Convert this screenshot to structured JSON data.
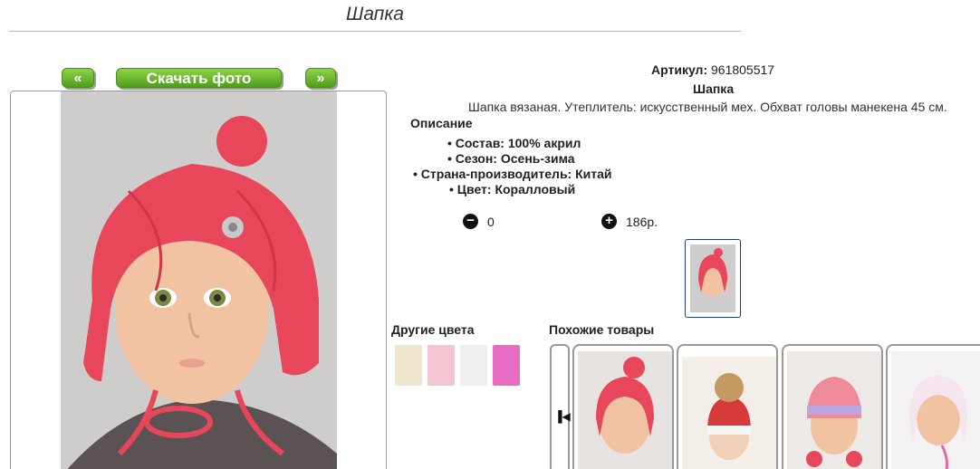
{
  "page": {
    "title": "Шапка"
  },
  "buttons": {
    "prev": "«",
    "download": "Скачать фото",
    "next": "»"
  },
  "product": {
    "article_label": "Артикул:",
    "article_value": "961805517",
    "name": "Шапка",
    "description": "Шапка вязаная. Утеплитель: искусственный мех. Обхват головы манекена 45 см.",
    "description_heading": "Описание",
    "specs": [
      "Состав: 100% акрил",
      "Сезон: Осень-зима",
      "Страна-производитель: Китай",
      "Цвет: Коралловый"
    ]
  },
  "quantity": {
    "minus_icon": "minus-circle-icon",
    "value": "0",
    "plus_icon": "plus-circle-icon",
    "price": "186р."
  },
  "sections": {
    "other_colors": "Другие цвета",
    "similar": "Похожие товары"
  },
  "colors": {
    "accent_green": "#5aa823",
    "hat_coral": "#e8465a",
    "thumb_border": "#1d3c7a"
  },
  "other_colors": [
    {
      "name": "cream",
      "hex": "#efe6cf"
    },
    {
      "name": "pink",
      "hex": "#f2c5d0"
    },
    {
      "name": "white",
      "hex": "#f1f1f1"
    },
    {
      "name": "magenta",
      "hex": "#e86bc4"
    }
  ]
}
